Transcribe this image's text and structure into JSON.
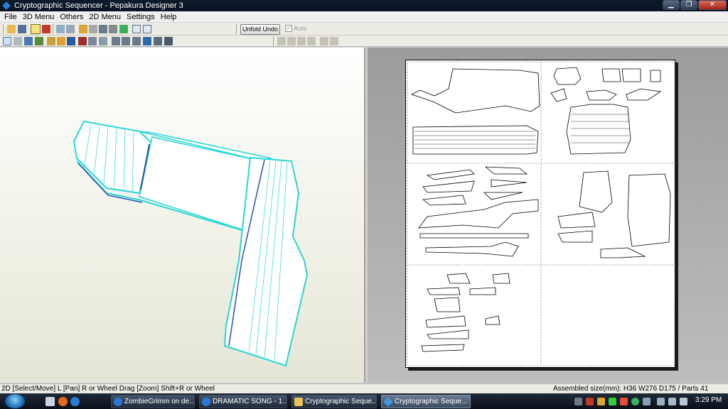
{
  "window": {
    "title": "Cryptographic Sequencer - Pepakura Designer 3",
    "controls": [
      "minimize",
      "maximize",
      "close"
    ]
  },
  "menu": {
    "items": [
      "File",
      "3D Menu",
      "Others",
      "2D Menu",
      "Settings",
      "Help"
    ]
  },
  "toolbar": {
    "unfold_undo_label": "Unfold Undo",
    "auto_label": "Auto",
    "auto_checked": true,
    "auto_enabled": false
  },
  "statusbar": {
    "hint": "2D [Select/Move] L [Pan] R or Wheel Drag [Zoom] Shift+R or Wheel",
    "assembled": "Assembled size(mm): H36 W276 D175 / Parts 41"
  },
  "taskbar": {
    "tasks": [
      {
        "label": "ZombieGrimm on de...",
        "icon": "ie-icon",
        "active": false
      },
      {
        "label": "DRAMATIC SONG - 1...",
        "icon": "ie-icon",
        "active": false
      },
      {
        "label": "Cryptographic Seque...",
        "icon": "folder-icon",
        "active": false
      },
      {
        "label": "Cryptographic Seque...",
        "icon": "pepakura-icon",
        "active": true
      }
    ],
    "clock": "3:29 PM"
  },
  "colors": {
    "model_edge": "#26d6d6",
    "model_fold": "#2a4fb0",
    "titlebar": "#0d1a2c"
  }
}
